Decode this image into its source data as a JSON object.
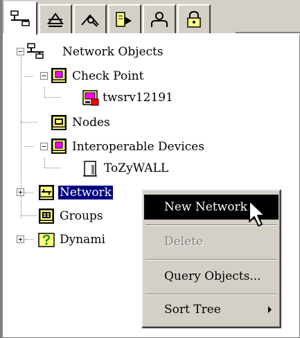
{
  "tabs": [
    {
      "icon": "network-objects-tab-icon"
    },
    {
      "icon": "services-tab-icon"
    },
    {
      "icon": "resources-tab-icon"
    },
    {
      "icon": "servers-tab-icon"
    },
    {
      "icon": "users-tab-icon"
    },
    {
      "icon": "vpn-lock-tab-icon"
    }
  ],
  "tree": {
    "root": "Network Objects",
    "check_point": "Check Point",
    "twsrv": "twsrv12191",
    "nodes": "Nodes",
    "interoperable": "Interoperable Devices",
    "tozywall": "ToZyWALL",
    "networks": "Network",
    "groups": "Groups",
    "dynamic": "Dynami"
  },
  "context_menu": {
    "new_network": "New Network...",
    "delete": "Delete",
    "query_objects": "Query Objects...",
    "sort_tree": "Sort Tree"
  },
  "colors": {
    "selection": "#000080",
    "menu_highlight": "#000000",
    "icon_yellow": "#ffff80",
    "icon_pink": "#ff00ff"
  }
}
